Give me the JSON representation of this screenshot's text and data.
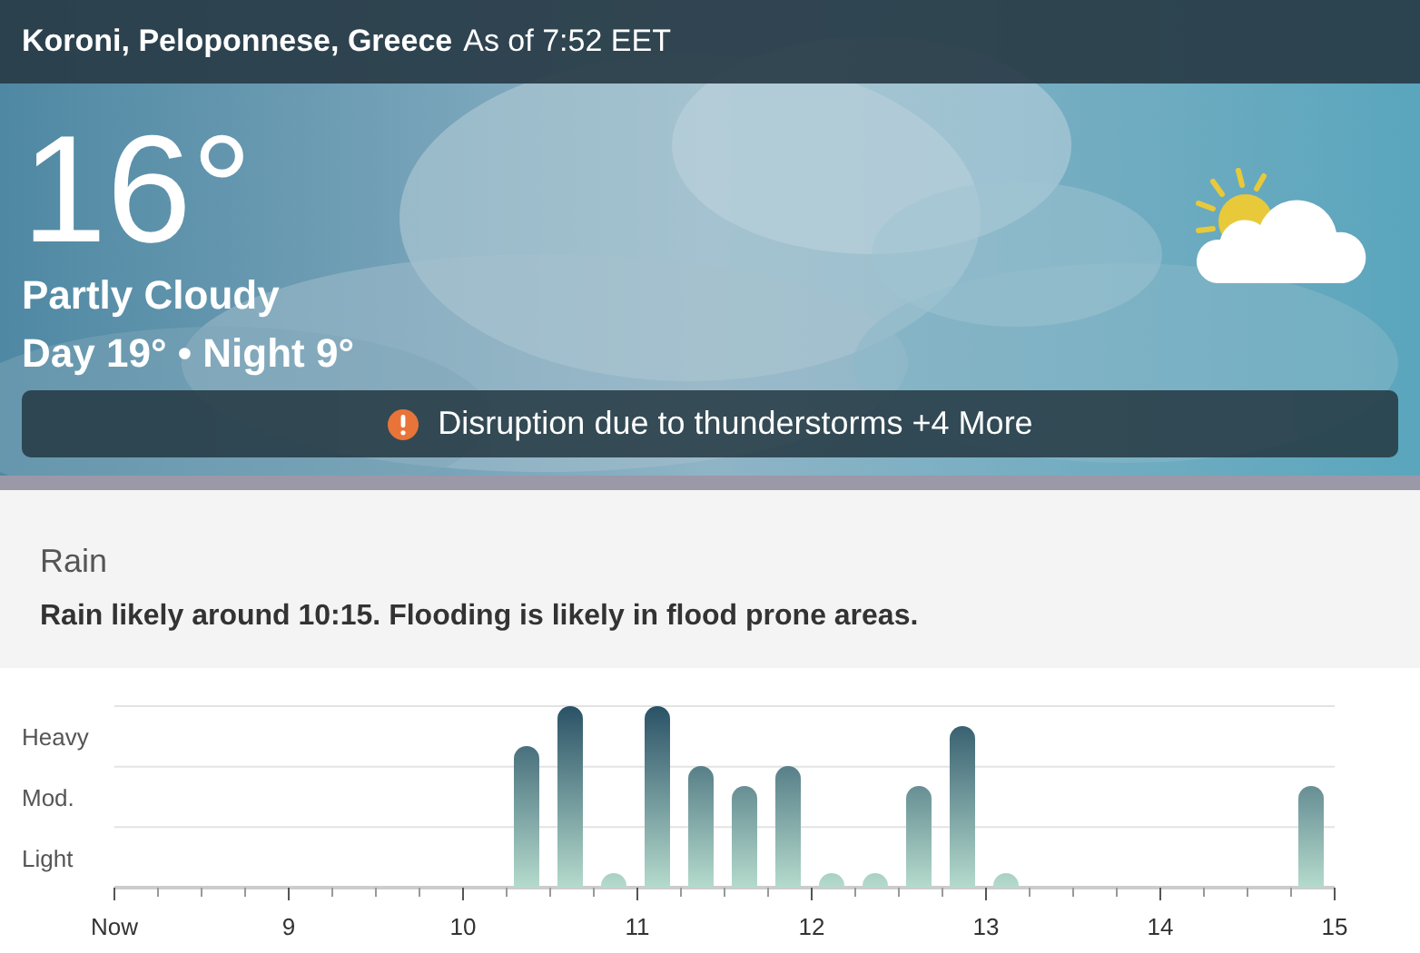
{
  "header": {
    "location": "Koroni, Peloponnese, Greece",
    "updated": "As of 7:52 EET"
  },
  "current": {
    "temperature": "16°",
    "condition": "Partly Cloudy",
    "day_night": "Day 19° • Night 9°"
  },
  "alert": {
    "text": "Disruption due to thunderstorms +4 More"
  },
  "rain": {
    "title": "Rain",
    "summary": "Rain likely around 10:15. Flooding is likely in flood prone areas.",
    "chart": {
      "intensity_labels": [
        "Heavy",
        "Mod.",
        "Light"
      ],
      "time_labels": [
        "Now",
        "9",
        "10",
        "11",
        "12",
        "13",
        "14",
        "15"
      ]
    }
  }
}
